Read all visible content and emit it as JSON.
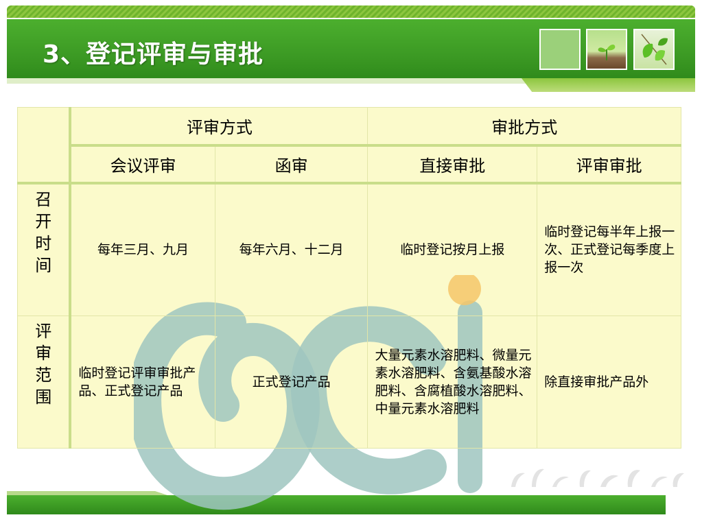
{
  "header": {
    "title": "3、登记评审与审批"
  },
  "table": {
    "group_headers": [
      "评审方式",
      "审批方式"
    ],
    "sub_headers": [
      "会议评审",
      "函审",
      "直接审批",
      "评审审批"
    ],
    "rows": [
      {
        "label_chars": [
          "召",
          "开",
          "时",
          "间"
        ],
        "cells": [
          "每年三月、九月",
          "每年六月、十二月",
          "临时登记按月上报",
          "临时登记每半年上报一次、正式登记每季度上报一次"
        ]
      },
      {
        "label_chars": [
          "评",
          "审",
          "范",
          "围"
        ],
        "cells": [
          "临时登记评审审批产品、正式登记产品",
          "正式登记产品",
          "大量元素水溶肥料、微量元素水溶肥料、含氨基酸水溶肥料、含腐植酸水溶肥料、中量元素水溶肥料",
          "除直接审批产品外"
        ]
      }
    ]
  },
  "watermark": {
    "text": "oci",
    "colors": {
      "o": "#9fc6c0",
      "c": "#9fc6c0",
      "i_dot": "#f4c56a"
    }
  },
  "colors": {
    "accent_green": "#3c9a24",
    "table_bg": "#fbfacb",
    "table_border": "#c9dd8a"
  }
}
